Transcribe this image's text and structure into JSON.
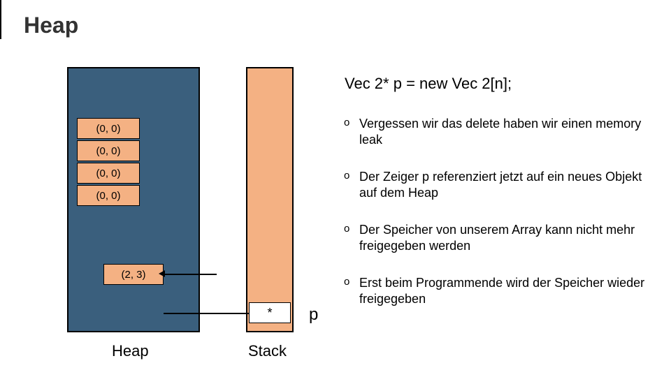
{
  "title": "Heap",
  "heap": {
    "label": "Heap",
    "array_cells": [
      "(0, 0)",
      "(0, 0)",
      "(0, 0)",
      "(0, 0)"
    ],
    "detached_cell": "(2, 3)"
  },
  "stack": {
    "label": "Stack",
    "pointer_cell": "*",
    "pointer_name": "p"
  },
  "code_line": "Vec 2* p = new Vec 2[n];",
  "bullets": [
    "Vergessen wir das delete haben wir einen memory leak",
    "Der Zeiger p referenziert jetzt auf ein neues Objekt auf dem Heap",
    "Der Speicher von unserem Array kann nicht mehr freigegeben werden",
    "Erst beim Programmende wird der Speicher wieder freigegeben"
  ]
}
